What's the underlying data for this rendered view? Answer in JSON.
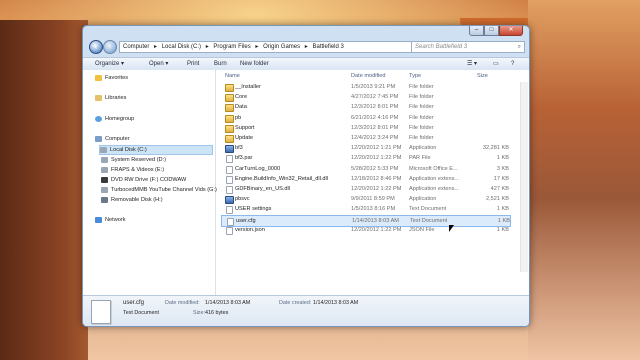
{
  "window": {
    "title_buttons": {
      "minimize": "–",
      "maximize": "□",
      "close": "✕"
    }
  },
  "address": {
    "back_icon": "back-arrow-icon",
    "forward_icon": "forward-arrow-icon",
    "path": [
      "Computer",
      "Local Disk (C:)",
      "Program Files",
      "Origin Games",
      "Battlefield 3"
    ],
    "separator": "▸"
  },
  "search": {
    "placeholder": "Search Battlefield 3"
  },
  "toolbar": {
    "organize": "Organize ▾",
    "open": "Open ▾",
    "print": "Print",
    "burn": "Burn",
    "new_folder": "New folder"
  },
  "nav": {
    "favorites": "Favorites",
    "libraries": "Libraries",
    "homegroup": "Homegroup",
    "computer": "Computer",
    "drives": [
      "Local Disk (C:)",
      "System Reserved (D:)",
      "FRAPS & Videos (E:)",
      "DVD RW Drive (F:) CODWAW",
      "TurbocedMMB YouTube Channel Vids (G:)",
      "Removable Disk (H:)"
    ],
    "network": "Network"
  },
  "columns": {
    "name": "Name",
    "date": "Date modified",
    "type": "Type",
    "size": "Size"
  },
  "files": [
    {
      "name": "__Installer",
      "date": "1/5/2013 9:21 PM",
      "type": "File folder",
      "size": "",
      "icon": "folder"
    },
    {
      "name": "Core",
      "date": "4/27/2012 7:45 PM",
      "type": "File folder",
      "size": "",
      "icon": "folder"
    },
    {
      "name": "Data",
      "date": "12/3/2012 8:01 PM",
      "type": "File folder",
      "size": "",
      "icon": "folder"
    },
    {
      "name": "pb",
      "date": "6/21/2012 4:16 PM",
      "type": "File folder",
      "size": "",
      "icon": "folder"
    },
    {
      "name": "Support",
      "date": "12/3/2012 8:01 PM",
      "type": "File folder",
      "size": "",
      "icon": "folder"
    },
    {
      "name": "Update",
      "date": "12/4/2012 3:24 PM",
      "type": "File folder",
      "size": "",
      "icon": "folder"
    },
    {
      "name": "bf3",
      "date": "12/20/2012 1:21 PM",
      "type": "Application",
      "size": "32,281 KB",
      "icon": "app"
    },
    {
      "name": "bf3.par",
      "date": "12/20/2012 1:22 PM",
      "type": "PAR File",
      "size": "1 KB",
      "icon": "file"
    },
    {
      "name": "CarTurnLog_0000",
      "date": "5/28/2012 5:33 PM",
      "type": "Microsoft Office E...",
      "size": "3 KB",
      "icon": "file"
    },
    {
      "name": "Engine.BuildInfo_Win32_Retail_dll.dll",
      "date": "12/18/2012 8:46 PM",
      "type": "Application extens...",
      "size": "17 KB",
      "icon": "file"
    },
    {
      "name": "GDFBinary_en_US.dll",
      "date": "12/20/2012 1:22 PM",
      "type": "Application extens...",
      "size": "427 KB",
      "icon": "file"
    },
    {
      "name": "pbsvc",
      "date": "9/9/2011 8:59 PM",
      "type": "Application",
      "size": "2,521 KB",
      "icon": "app"
    },
    {
      "name": "USER settings",
      "date": "1/5/2013 8:16 PM",
      "type": "Text Document",
      "size": "1 KB",
      "icon": "file"
    },
    {
      "name": "user.cfg",
      "date": "1/14/2013 8:03 AM",
      "type": "Text Document",
      "size": "1 KB",
      "icon": "file"
    },
    {
      "name": "version.json",
      "date": "12/20/2012 1:22 PM",
      "type": "JSON File",
      "size": "1 KB",
      "icon": "file"
    }
  ],
  "selected_index": 13,
  "details": {
    "name": "user.cfg",
    "type": "Text Document",
    "modified_label": "Date modified:",
    "modified": "1/14/2013 8:03 AM",
    "created_label": "Date created:",
    "created": "1/14/2013 8:03 AM",
    "size_label": "Size:",
    "size": "416 bytes"
  }
}
